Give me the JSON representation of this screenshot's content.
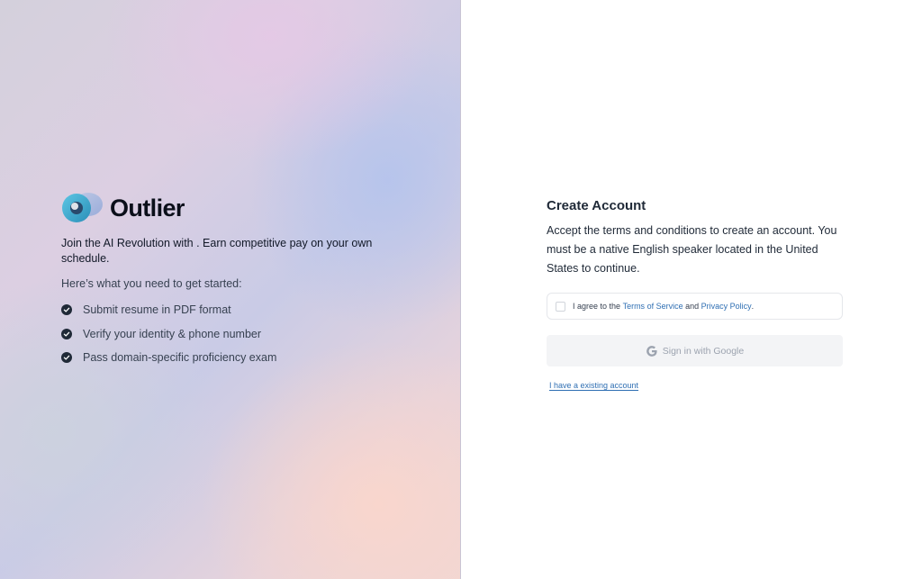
{
  "brand": {
    "name": "Outlier"
  },
  "left": {
    "tagline": "Join the AI Revolution with . Earn competitive pay on your own schedule.",
    "intro": "Here’s what you need to get started:",
    "requirements": [
      {
        "label": "Submit resume in PDF format",
        "icon": "check-circle-icon"
      },
      {
        "label": "Verify your identity & phone number",
        "icon": "check-circle-icon"
      },
      {
        "label": "Pass domain-specific proficiency exam",
        "icon": "check-circle-icon"
      }
    ]
  },
  "form": {
    "title": "Create Account",
    "description": "Accept the terms and conditions to create an account. You must be a native English speaker located in the United States to continue.",
    "agree": {
      "prefix": "I agree to the",
      "terms_link": "Terms of Service",
      "conjunction": "and",
      "privacy_link": "Privacy Policy",
      "suffix": ".",
      "checked": false
    },
    "google_button": {
      "label": "Sign in with Google",
      "icon": "google-icon",
      "disabled": true
    },
    "existing_account_link": "I have a existing account"
  },
  "colors": {
    "link": "#2f6fb3",
    "check": "#1f2937",
    "button_bg": "#f3f4f6"
  }
}
